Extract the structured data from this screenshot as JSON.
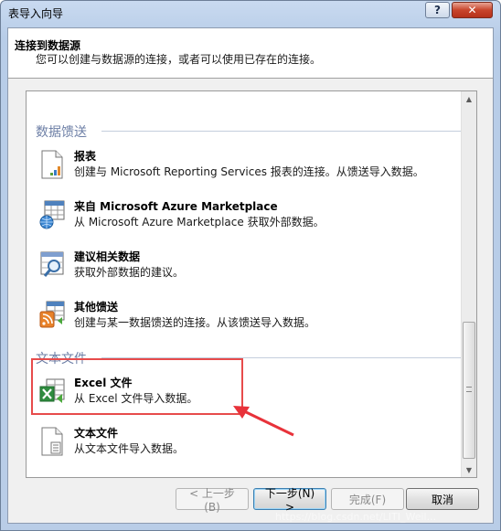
{
  "window": {
    "title": "表导入向导",
    "help_label": "?",
    "close_label": "✕"
  },
  "header": {
    "title": "连接到数据源",
    "subtitle": "您可以创建与数据源的连接，或者可以使用已存在的连接。"
  },
  "sections": [
    {
      "label": "数据馈送",
      "items": [
        {
          "icon": "report-icon",
          "title": "报表",
          "desc": "创建与 Microsoft Reporting Services 报表的连接。从馈送导入数据。"
        },
        {
          "icon": "azure-marketplace-icon",
          "title": "来自 Microsoft Azure Marketplace",
          "desc": "从 Microsoft Azure Marketplace 获取外部数据。"
        },
        {
          "icon": "suggest-data-icon",
          "title": "建议相关数据",
          "desc": "获取外部数据的建议。"
        },
        {
          "icon": "feed-icon",
          "title": "其他馈送",
          "desc": "创建与某一数据馈送的连接。从该馈送导入数据。"
        }
      ]
    },
    {
      "label": "文本文件",
      "items": [
        {
          "icon": "excel-file-icon",
          "title": "Excel 文件",
          "desc": "从 Excel 文件导入数据。"
        },
        {
          "icon": "text-file-icon",
          "title": "文本文件",
          "desc": "从文本文件导入数据。"
        }
      ]
    }
  ],
  "buttons": {
    "back": "< 上一步(B)",
    "next": "下一步(N) >",
    "finish": "完成(F)",
    "cancel": "取消"
  },
  "watermark": "https://blog.csdn.net/LITI_Weil..."
}
